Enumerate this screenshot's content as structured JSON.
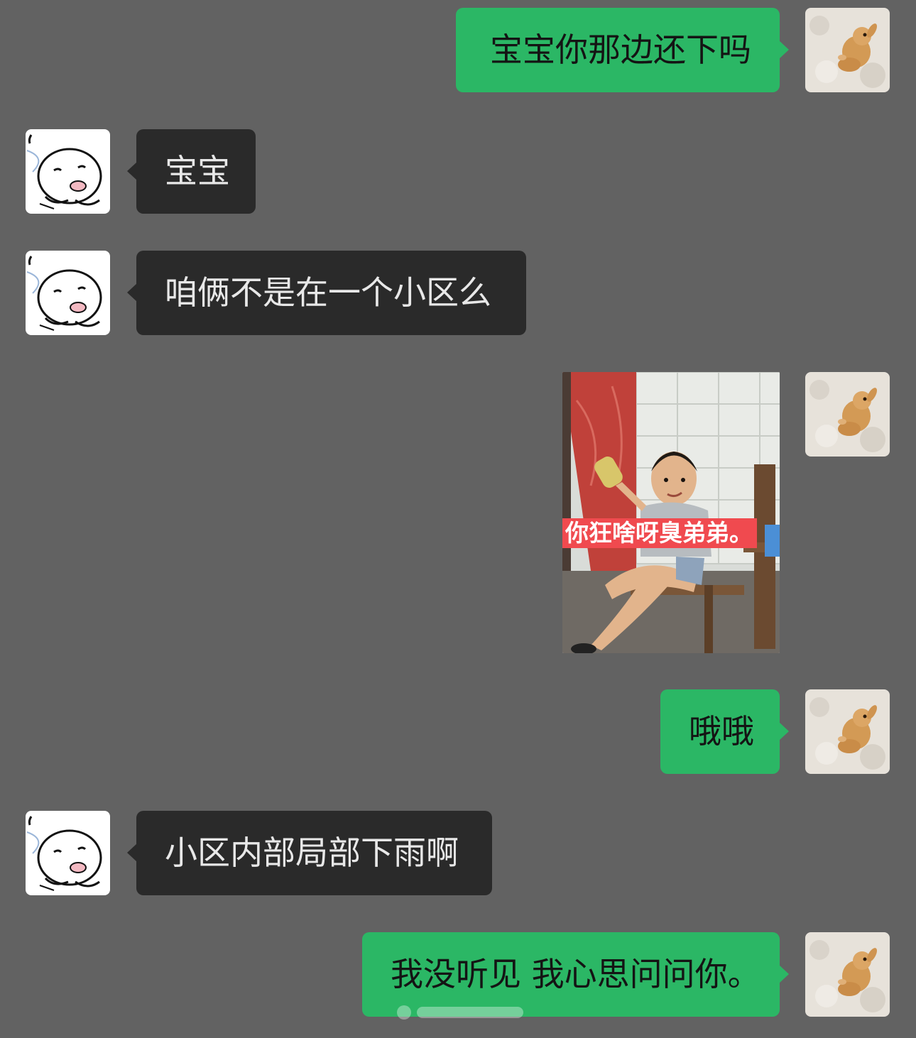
{
  "chat": {
    "messages": [
      {
        "sender": "me",
        "text": "宝宝你那边还下吗"
      },
      {
        "sender": "other",
        "text": "宝宝"
      },
      {
        "sender": "other",
        "text": "咱俩不是在一个小区么"
      },
      {
        "sender": "me",
        "type": "image",
        "caption": "你狂啥呀臭弟弟。"
      },
      {
        "sender": "me",
        "text": "哦哦"
      },
      {
        "sender": "other",
        "text": "小区内部局部下雨啊"
      },
      {
        "sender": "me",
        "text": "我没听见 我心思问问你。"
      }
    ]
  },
  "colors": {
    "background": "#626262",
    "my_bubble": "#2bb765",
    "other_bubble": "#2a2a2a",
    "caption_bg": "#f04a4f"
  },
  "icons": {
    "my_avatar": "rabbit-avatar",
    "other_avatar": "cartoon-face-avatar"
  }
}
